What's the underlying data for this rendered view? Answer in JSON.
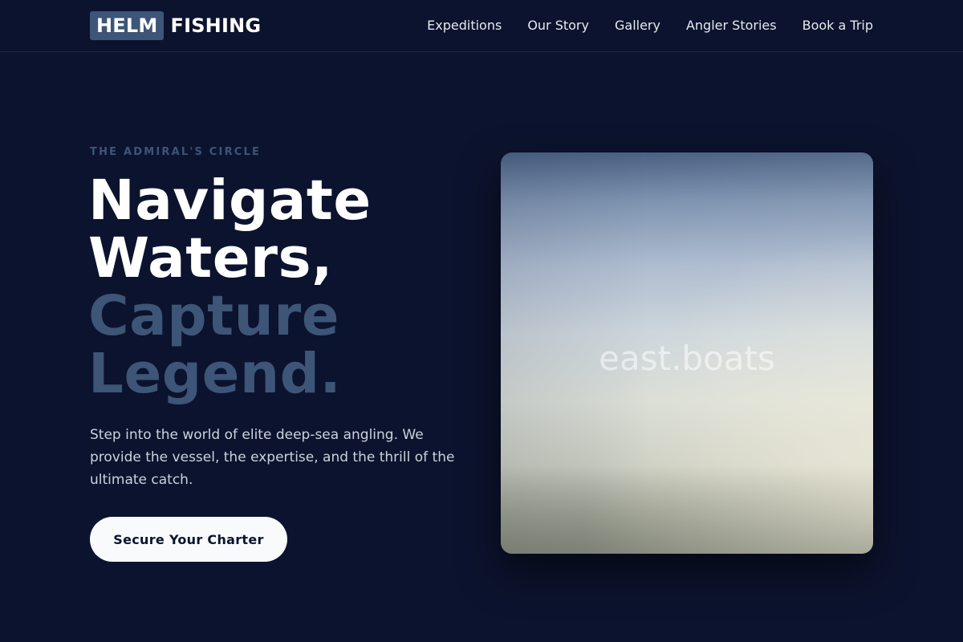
{
  "header": {
    "logo_box": "HELM",
    "logo_rest": "FISHING",
    "nav": [
      "Expeditions",
      "Our Story",
      "Gallery",
      "Angler Stories",
      "Book a Trip"
    ]
  },
  "hero": {
    "eyebrow": "THE ADMIRAL'S CIRCLE",
    "headline_line1": "Navigate",
    "headline_line2": "Waters,",
    "headline_line3": "Capture",
    "headline_line4": "Legend.",
    "subcopy": "Step into the world of elite deep-sea angling. We provide the vessel, the expertise, and the thrill of the ultimate catch.",
    "cta_label": "Secure Your Charter",
    "image_caption": "east.boats"
  },
  "colors": {
    "background": "#0c132e",
    "accent": "#3d5577",
    "cta_bg": "#f8fafc"
  }
}
